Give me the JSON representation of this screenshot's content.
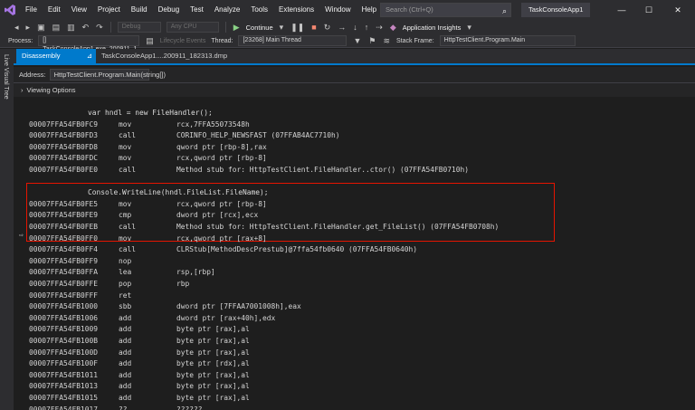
{
  "titlebar": {
    "menu": [
      "File",
      "Edit",
      "View",
      "Project",
      "Build",
      "Debug",
      "Test",
      "Analyze",
      "Tools",
      "Extensions",
      "Window",
      "Help"
    ],
    "search_placeholder": "Search (Ctrl+Q)",
    "app_name": "TaskConsoleApp1"
  },
  "toolbar1": {
    "config": "Debug",
    "platform": "Any CPU",
    "continue_label": "Continue",
    "app_insights": "Application Insights"
  },
  "toolbar2": {
    "process_label": "Process:",
    "process_value": "[] TaskConsoleApp1.exe_200911_1",
    "lifecycle": "Lifecycle Events",
    "thread_label": "Thread:",
    "thread_value": "[23268] Main Thread",
    "stack_label": "Stack Frame:",
    "stack_value": "HttpTestClient.Program.Main"
  },
  "left_rail": "Live Visual Tree",
  "tabs": {
    "active": "Disassembly",
    "inactive": "TaskConsoleApp1....200911_182313.dmp"
  },
  "address": {
    "label": "Address:",
    "value": "HttpTestClient.Program.Main(string[])"
  },
  "viewing_options": "Viewing Options",
  "code": [
    {
      "type": "src",
      "text": "var hndl = new FileHandler();"
    },
    {
      "type": "asm",
      "addr": "00007FFA54FB0FC9",
      "mn": "mov",
      "op": "rcx,7FFA55073548h"
    },
    {
      "type": "asm",
      "addr": "00007FFA54FB0FD3",
      "mn": "call",
      "op": "CORINFO_HELP_NEWSFAST (07FFAB4AC7710h)"
    },
    {
      "type": "asm",
      "addr": "00007FFA54FB0FD8",
      "mn": "mov",
      "op": "qword ptr [rbp-8],rax"
    },
    {
      "type": "asm",
      "addr": "00007FFA54FB0FDC",
      "mn": "mov",
      "op": "rcx,qword ptr [rbp-8]"
    },
    {
      "type": "asm",
      "addr": "00007FFA54FB0FE0",
      "mn": "call",
      "op": "Method stub for: HttpTestClient.FileHandler..ctor() (07FFA54FB0710h)"
    },
    {
      "type": "blank"
    },
    {
      "type": "src",
      "text": "Console.WriteLine(hndl.FileList.FileName);"
    },
    {
      "type": "asm",
      "addr": "00007FFA54FB0FE5",
      "mn": "mov",
      "op": "rcx,qword ptr [rbp-8]"
    },
    {
      "type": "asm",
      "addr": "00007FFA54FB0FE9",
      "mn": "cmp",
      "op": "dword ptr [rcx],ecx"
    },
    {
      "type": "asm",
      "addr": "00007FFA54FB0FEB",
      "mn": "call",
      "op": "Method stub for: HttpTestClient.FileHandler.get_FileList() (07FFA54FB0708h)"
    },
    {
      "type": "asm",
      "addr": "00007FFA54FB0FF0",
      "mn": "mov",
      "op": "rcx,qword ptr [rax+8]"
    },
    {
      "type": "asm",
      "addr": "00007FFA54FB0FF4",
      "mn": "call",
      "op": "CLRStub[MethodDescPrestub]@7ffa54fb0640 (07FFA54FB0640h)"
    },
    {
      "type": "asm",
      "addr": "00007FFA54FB0FF9",
      "mn": "nop",
      "op": ""
    },
    {
      "type": "asm",
      "addr": "00007FFA54FB0FFA",
      "mn": "lea",
      "op": "rsp,[rbp]"
    },
    {
      "type": "asm",
      "addr": "00007FFA54FB0FFE",
      "mn": "pop",
      "op": "rbp"
    },
    {
      "type": "asm",
      "addr": "00007FFA54FB0FFF",
      "mn": "ret",
      "op": ""
    },
    {
      "type": "asm",
      "addr": "00007FFA54FB1000",
      "mn": "sbb",
      "op": "dword ptr [7FFAA7001008h],eax"
    },
    {
      "type": "asm",
      "addr": "00007FFA54FB1006",
      "mn": "add",
      "op": "dword ptr [rax+40h],edx"
    },
    {
      "type": "asm",
      "addr": "00007FFA54FB1009",
      "mn": "add",
      "op": "byte ptr [rax],al"
    },
    {
      "type": "asm",
      "addr": "00007FFA54FB100B",
      "mn": "add",
      "op": "byte ptr [rax],al"
    },
    {
      "type": "asm",
      "addr": "00007FFA54FB100D",
      "mn": "add",
      "op": "byte ptr [rax],al"
    },
    {
      "type": "asm",
      "addr": "00007FFA54FB100F",
      "mn": "add",
      "op": "byte ptr [rdx],al"
    },
    {
      "type": "asm",
      "addr": "00007FFA54FB1011",
      "mn": "add",
      "op": "byte ptr [rax],al"
    },
    {
      "type": "asm",
      "addr": "00007FFA54FB1013",
      "mn": "add",
      "op": "byte ptr [rax],al"
    },
    {
      "type": "asm",
      "addr": "00007FFA54FB1015",
      "mn": "add",
      "op": "byte ptr [rax],al"
    },
    {
      "type": "asm",
      "addr": "00007FFA54FB1017",
      "mn": "??",
      "op": "??????"
    }
  ],
  "colors": {
    "accent": "#007acc",
    "highlight_border": "#e51400",
    "play_green": "#89d185",
    "stop_red": "#f48771"
  },
  "icons": [
    "vs-logo-icon",
    "search-icon",
    "play-icon",
    "pause-icon",
    "stop-icon",
    "restart-icon",
    "step-over-icon",
    "step-into-icon",
    "step-out-icon",
    "filter-icon",
    "instruction-pointer-icon"
  ]
}
